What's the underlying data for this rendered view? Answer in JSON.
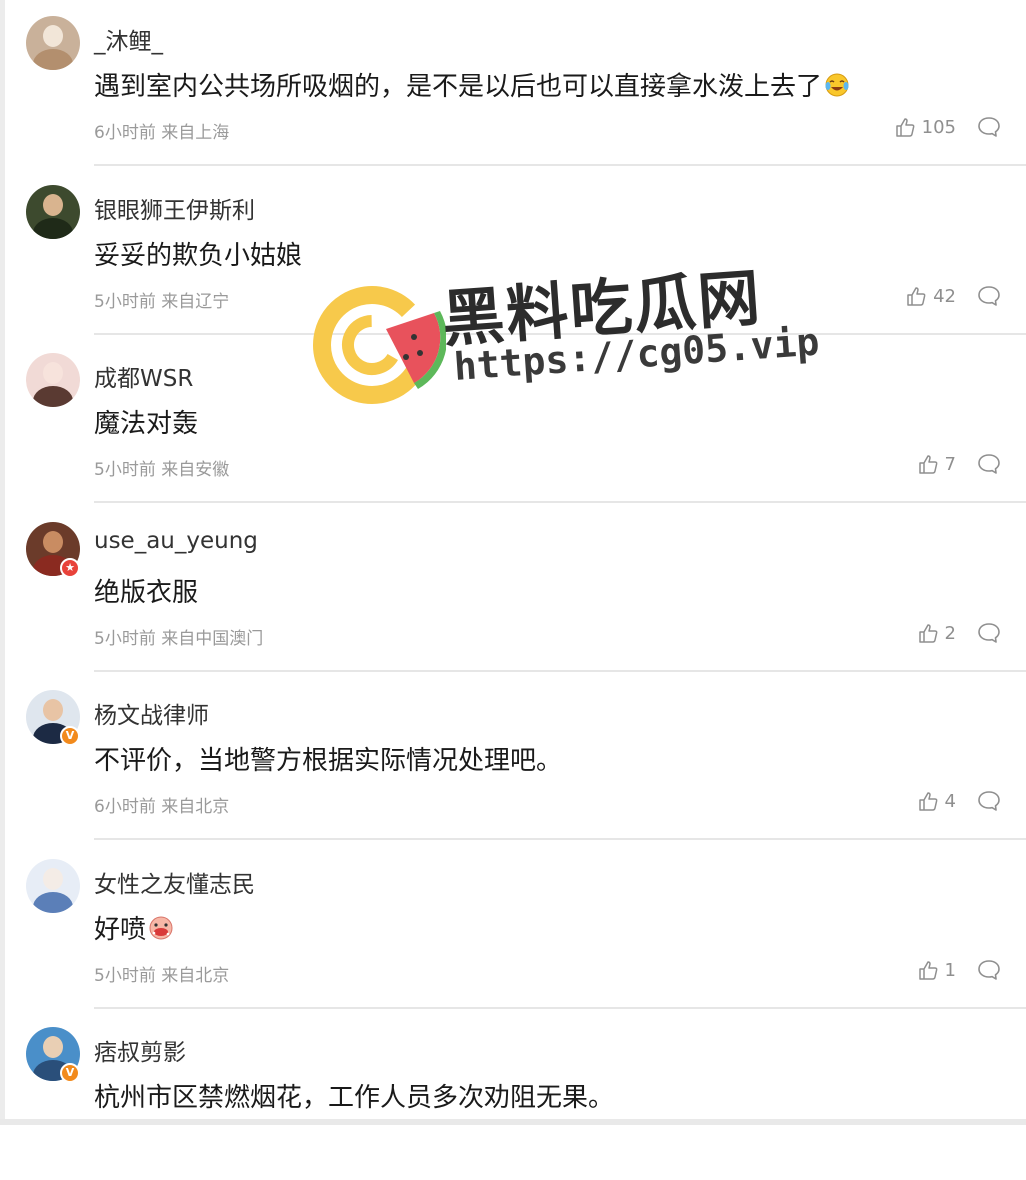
{
  "comments": [
    {
      "username": "_沐鲤_",
      "text": "遇到室内公共场所吸烟的，是不是以后也可以直接拿水泼上去了",
      "emoji": "laugh-cry-emoji",
      "meta": "6小时前 来自上海",
      "likes": "105",
      "avatar": {
        "bg": "#c9b19a",
        "face": "#f2e6d8",
        "body": "#b38f6e"
      },
      "badge": null
    },
    {
      "username": "银眼狮王伊斯利",
      "text": "妥妥的欺负小姑娘",
      "emoji": null,
      "meta": "5小时前 来自辽宁",
      "likes": "42",
      "avatar": {
        "bg": "#3d4a2e",
        "face": "#d9b48f",
        "body": "#1f2a18"
      },
      "badge": null
    },
    {
      "username": "成都WSR",
      "text": "魔法对轰",
      "emoji": null,
      "meta": "5小时前 来自安徽",
      "likes": "7",
      "avatar": {
        "bg": "#f1dad6",
        "face": "#f7e3dc",
        "body": "#5a3a32"
      },
      "badge": null
    },
    {
      "username": "use_au_yeung",
      "text": "绝版衣服",
      "emoji": null,
      "meta": "5小时前 来自中国澳门",
      "likes": "2",
      "avatar": {
        "bg": "#6b3b2a",
        "face": "#c98c62",
        "body": "#8a2a20"
      },
      "badge": {
        "color": "#e8423a",
        "glyph": "★"
      }
    },
    {
      "username": "杨文战律师",
      "text": "不评价，当地警方根据实际情况处理吧。",
      "emoji": null,
      "meta": "6小时前 来自北京",
      "likes": "4",
      "avatar": {
        "bg": "#dfe6ee",
        "face": "#e8c4a5",
        "body": "#1c2a44"
      },
      "badge": {
        "color": "#f28a1c",
        "glyph": "V"
      }
    },
    {
      "username": "女性之友懂志民",
      "text": "好喷",
      "emoji": "spray-emoji",
      "meta": "5小时前 来自北京",
      "likes": "1",
      "avatar": {
        "bg": "#e7edf6",
        "face": "#f4ece6",
        "body": "#5b7fb8"
      },
      "badge": null
    },
    {
      "username": "痞叔剪影",
      "text": "杭州市区禁燃烟花，工作人员多次劝阻无果。",
      "emoji": null,
      "meta": "",
      "likes": "",
      "avatar": {
        "bg": "#4a8fc9",
        "face": "#e9cfb4",
        "body": "#2a4f7a"
      },
      "badge": {
        "color": "#f28a1c",
        "glyph": "V"
      }
    }
  ],
  "watermark": {
    "title": "黑料吃瓜网",
    "url": "https://cg05.vip",
    "logo": "watermelon-logo-icon"
  },
  "colors": {
    "text": "#1a1a1a",
    "meta": "#9a9a9a",
    "divider": "#e6e6e6",
    "logo_ring": "#f7c94b",
    "logo_melon": "#5db85a"
  }
}
